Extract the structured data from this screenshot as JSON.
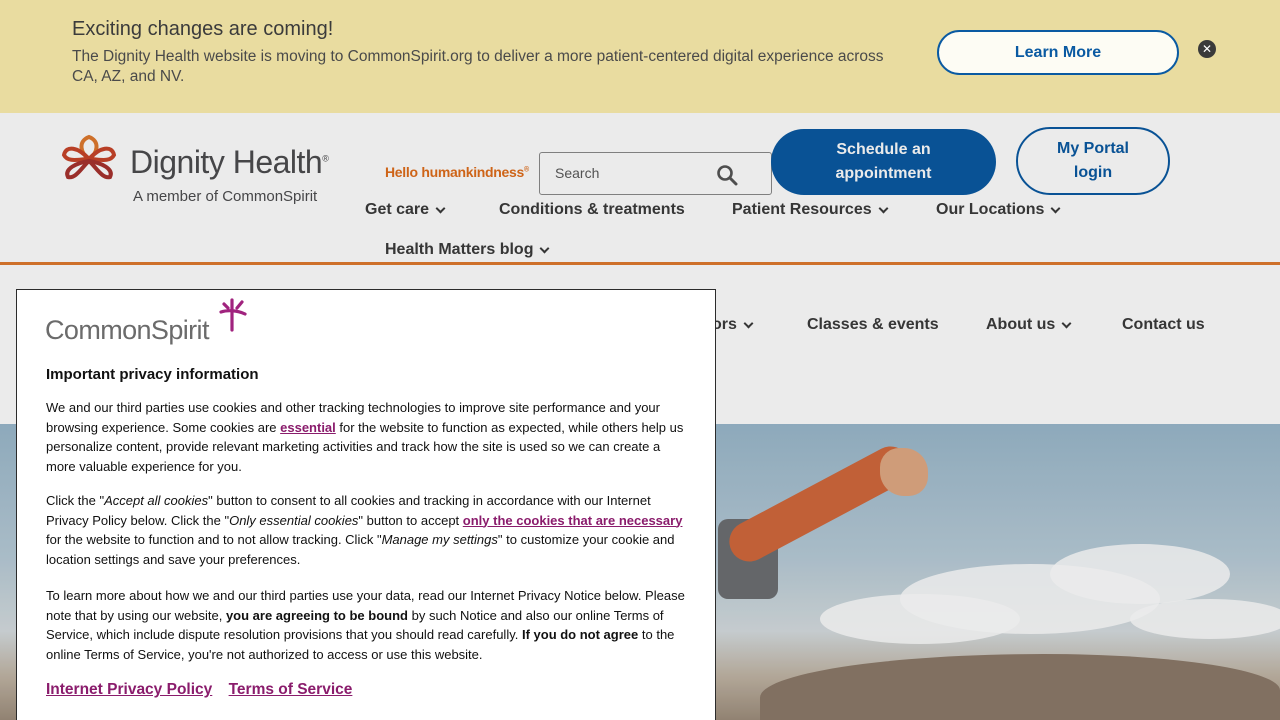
{
  "banner": {
    "title": "Exciting changes are coming!",
    "text": "The Dignity Health website is moving to CommonSpirit.org to deliver a more patient-centered digital experience across CA, AZ, and NV.",
    "learn_more": "Learn More",
    "close_icon": "close-circle-icon"
  },
  "header": {
    "logo_word": "Dignity Health",
    "logo_registered": "®",
    "logo_sub": "A member of CommonSpirit",
    "tagline": "Hello humankindness",
    "tagline_mark": "®",
    "search_placeholder": "Search",
    "schedule": "Schedule an appointment",
    "portal": "My Portal login",
    "nav": [
      {
        "label": "Get care"
      },
      {
        "label": "Conditions & treatments"
      },
      {
        "label": "Patient Resources"
      },
      {
        "label": "Our Locations"
      },
      {
        "label": "Health Matters blog"
      }
    ]
  },
  "subnav": {
    "partial": "ors",
    "classes": "Classes & events",
    "about": "About us",
    "contact": "Contact us"
  },
  "privacy": {
    "brand": "CommonSpirit",
    "title": "Important privacy information",
    "p1_a": "We and our third parties use cookies and other tracking technologies to improve site performance and your browsing experience. Some cookies are ",
    "p1_link": "essential",
    "p1_b": " for the website to function as expected, while others help us personalize content, provide relevant marketing activities and track how the site is used so we can create a more valuable experience for you.",
    "p2_a": "Click the \"",
    "p2_accept": "Accept all cookies",
    "p2_b": "\" button to consent to all cookies and tracking in accordance with our Internet Privacy Policy below. Click the \"",
    "p2_only": "Only essential cookies",
    "p2_c": "\" button to accept ",
    "p2_link": "only the cookies that are necessary",
    "p2_d": " for the website to function and to not allow tracking. Click \"",
    "p2_manage": "Manage my settings",
    "p2_e": "\" to customize your cookie and location settings and save your preferences.",
    "p3_a": "To learn more about how we and our third parties use your data, read our Internet Privacy Notice below. Please note that by using our website, ",
    "p3_bold1": "you are agreeing to be bound",
    "p3_b": " by such Notice and also our online Terms of Service, which include dispute resolution provisions that you should read carefully. ",
    "p3_bold2": "If you do not agree",
    "p3_c": " to the online Terms of Service, you're not authorized to access or use this website.",
    "link_policy": "Internet Privacy Policy",
    "link_terms": "Terms of Service"
  },
  "colors": {
    "banner_bg": "#e9dca0",
    "brand_blue": "#0a5aa2",
    "accent_orange": "#e07a2e",
    "link_magenta": "#8a1c6c"
  }
}
